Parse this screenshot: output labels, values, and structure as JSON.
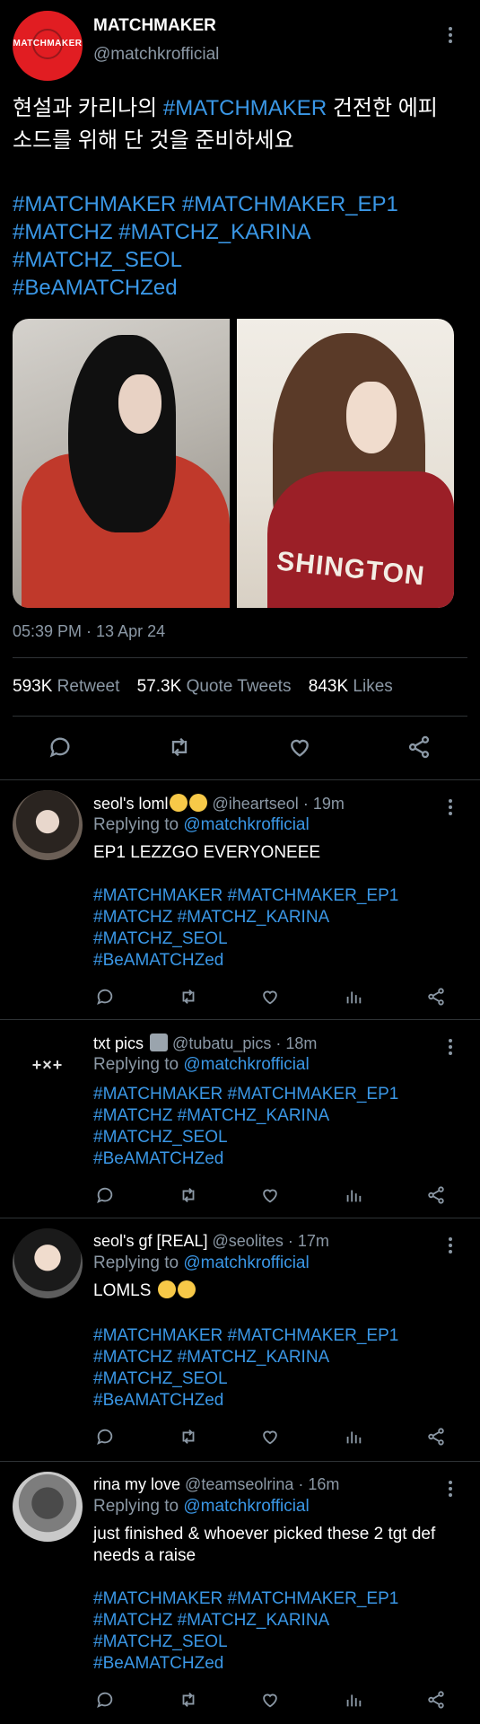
{
  "main_tweet": {
    "avatar_text": "MATCHMAKER",
    "name": "MATCHMAKER",
    "handle": "@matchkrofficial",
    "text_line1_pre": "현설과 카리나의 ",
    "text_line1_tag": "#MATCHMAKER",
    "text_line1_post": " 건전한 에피",
    "text_line2": "소드를 위해 단 것을 준비하세요",
    "hashtags": [
      "#MATCHMAKER #MATCHMAKER_EP1",
      "#MATCHZ #MATCHZ_KARINA",
      "#MATCHZ_SEOL",
      "#BeAMATCHZed"
    ],
    "shirt_text": "SHINGTON",
    "timestamp": "05:39 PM · 13 Apr 24",
    "stats": [
      {
        "value": "593K",
        "label": "Retweet"
      },
      {
        "value": "57.3K",
        "label": "Quote Tweets"
      },
      {
        "value": "843K",
        "label": "Likes"
      }
    ]
  },
  "replies": [
    {
      "name": "seol's loml",
      "handle": "@iheartseol",
      "time": "· 19m",
      "replying_label": "Replying to ",
      "replying_to": "@matchkrofficial",
      "body": "EP1 LEZZGO EVERYONEEE",
      "hashtags": [
        "#MATCHMAKER #MATCHMAKER_EP1",
        "#MATCHZ #MATCHZ_KARINA",
        "#MATCHZ_SEOL",
        "#BeAMATCHZed"
      ]
    },
    {
      "name": "txt pics",
      "handle": "@tubatu_pics",
      "time": "· 18m",
      "avatar_text": "+×+",
      "replying_label": "Replying to ",
      "replying_to": "@matchkrofficial",
      "body": "",
      "hashtags": [
        "#MATCHMAKER #MATCHMAKER_EP1",
        "#MATCHZ #MATCHZ_KARINA",
        "#MATCHZ_SEOL",
        "#BeAMATCHZed"
      ]
    },
    {
      "name": "seol's gf [REAL]",
      "handle": "@seolites",
      "time": "· 17m",
      "replying_label": "Replying to ",
      "replying_to": "@matchkrofficial",
      "body": "LOMLS",
      "hashtags": [
        "#MATCHMAKER #MATCHMAKER_EP1",
        "#MATCHZ #MATCHZ_KARINA",
        "#MATCHZ_SEOL",
        "#BeAMATCHZed"
      ]
    },
    {
      "name": "rina my love",
      "handle": "@teamseolrina",
      "time": "· 16m",
      "replying_label": "Replying to ",
      "replying_to": "@matchkrofficial",
      "body_line1": "just finished & whoever picked these 2 tgt def",
      "body_line2": "needs a raise",
      "hashtags": [
        "#MATCHMAKER #MATCHMAKER_EP1",
        "#MATCHZ #MATCHZ_KARINA",
        "#MATCHZ_SEOL",
        "#BeAMATCHZed"
      ]
    }
  ],
  "colors": {
    "background": "#000000",
    "link": "#3a97e6",
    "muted": "#8b98a5",
    "brand": "#e11d22"
  },
  "icons": [
    "reply-icon",
    "retweet-icon",
    "like-icon",
    "share-icon",
    "views-icon",
    "more-icon"
  ]
}
